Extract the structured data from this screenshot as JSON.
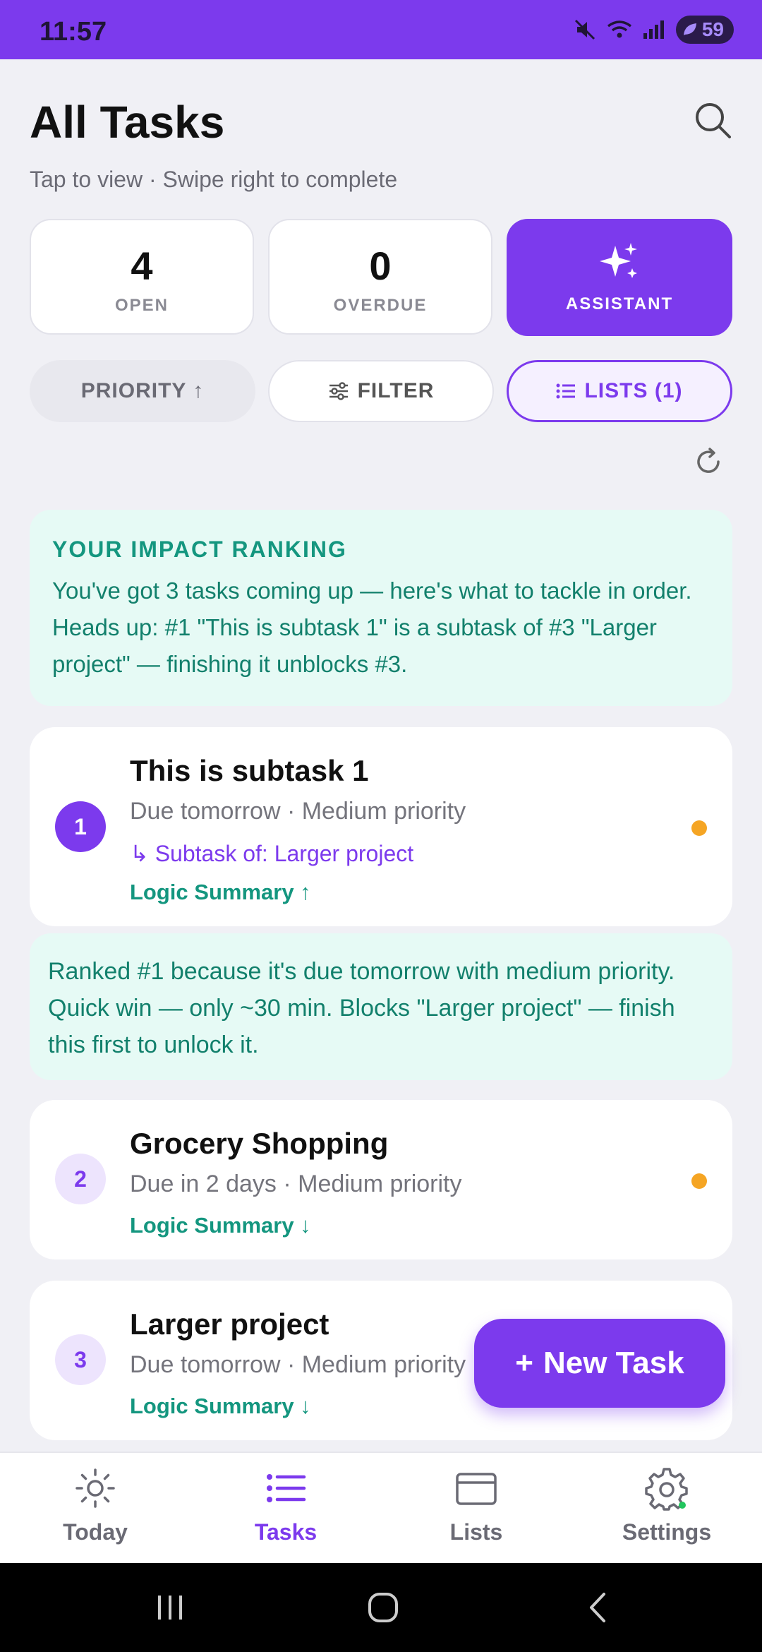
{
  "status_bar": {
    "time": "11:57",
    "battery": "59"
  },
  "header": {
    "title": "All Tasks",
    "subtitle": "Tap to view · Swipe right to complete"
  },
  "stats": {
    "open": {
      "value": "4",
      "label": "OPEN"
    },
    "overdue": {
      "value": "0",
      "label": "OVERDUE"
    },
    "assistant": {
      "label": "ASSISTANT"
    }
  },
  "controls": {
    "priority": "PRIORITY ↑",
    "filter": "FILTER",
    "lists": "LISTS (1)"
  },
  "impact": {
    "title": "YOUR IMPACT RANKING",
    "text": "You've got 3 tasks coming up — here's what to tackle in order. Heads up: #1 \"This is subtask 1\" is a subtask of #3 \"Larger project\" — finishing it unblocks #3."
  },
  "tasks": [
    {
      "rank": "1",
      "title": "This is subtask 1",
      "meta": "Due tomorrow · Medium priority",
      "subtask_of": "↳ Subtask of: Larger project",
      "logic": "Logic Summary ↑"
    },
    {
      "rank": "2",
      "title": "Grocery Shopping",
      "meta": "Due in 2 days · Medium priority",
      "logic": "Logic Summary ↓"
    },
    {
      "rank": "3",
      "title": "Larger project",
      "meta": "Due tomorrow · Medium priority",
      "logic": "Logic Summary ↓"
    }
  ],
  "explanation": "Ranked #1 because it's due tomorrow with medium priority. Quick win — only ~30 min. Blocks \"Larger project\" — finish this first to unlock it.",
  "fab": {
    "plus": "+",
    "label": "New Task"
  },
  "nav": {
    "today": "Today",
    "tasks": "Tasks",
    "lists": "Lists",
    "settings": "Settings"
  },
  "colors": {
    "accent": "#7c3aed",
    "teal": "#14967f",
    "priority_dot": "#f5a524"
  }
}
